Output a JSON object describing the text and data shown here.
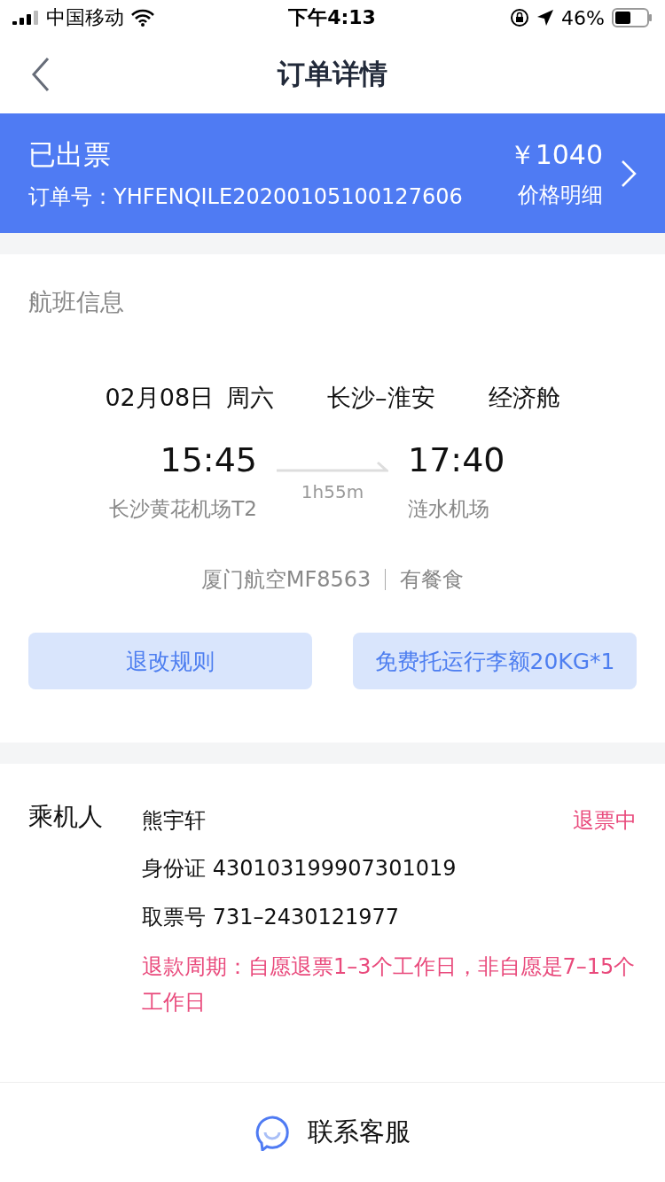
{
  "status_bar": {
    "carrier": "中国移动",
    "time": "下午4:13",
    "battery": "46%"
  },
  "nav": {
    "title": "订单详情"
  },
  "order": {
    "status": "已出票",
    "order_no": "订单号：YHFENQILE20200105100127606",
    "price": "￥1040",
    "price_link": "价格明细"
  },
  "flight": {
    "heading": "航班信息",
    "date": "02月08日",
    "weekday": "周六",
    "route": "长沙–淮安",
    "cabin": "经济舱",
    "depart_time": "15:45",
    "depart_airport": "长沙黄花机场T2",
    "duration": "1h55m",
    "arrive_time": "17:40",
    "arrive_airport": "涟水机场",
    "airline": "厦门航空MF8563",
    "meal": "有餐食",
    "buttons": [
      "退改规则",
      "免费托运行李额20KG*1"
    ]
  },
  "passengers": {
    "label": "乘机人",
    "items": [
      {
        "name": "熊宇轩",
        "status": "退票中",
        "lines": [
          "身份证 430103199907301019",
          "取票号 731–2430121977"
        ],
        "note": "退款周期：自愿退票1–3个工作日，非自愿是7–15个工作日"
      }
    ]
  },
  "footer": {
    "contact": "联系客服"
  }
}
